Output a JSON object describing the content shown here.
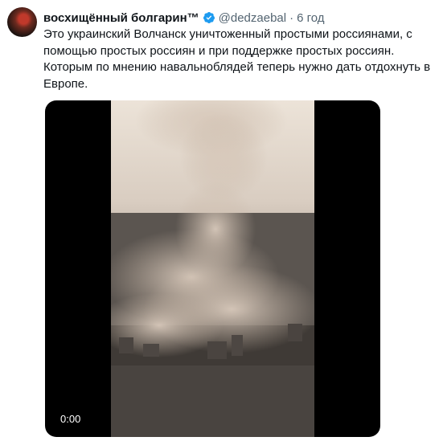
{
  "tweet": {
    "author_name": "восхищённый болгарин™",
    "handle": "@dedzaebal",
    "separator": "·",
    "time": "6 год",
    "text_lines": [
      "Это украинский Волчанск уничтоженный простыми россиянами, с",
      "помощью простых россиян и при поддержке простых россиян.",
      "Которым по мнению навальноблядей теперь нужно дать отдохнуть в",
      "Европе."
    ]
  },
  "media": {
    "duration": "0:00"
  },
  "colors": {
    "verified": "#1d9bf0",
    "secondary_text": "#536471"
  }
}
